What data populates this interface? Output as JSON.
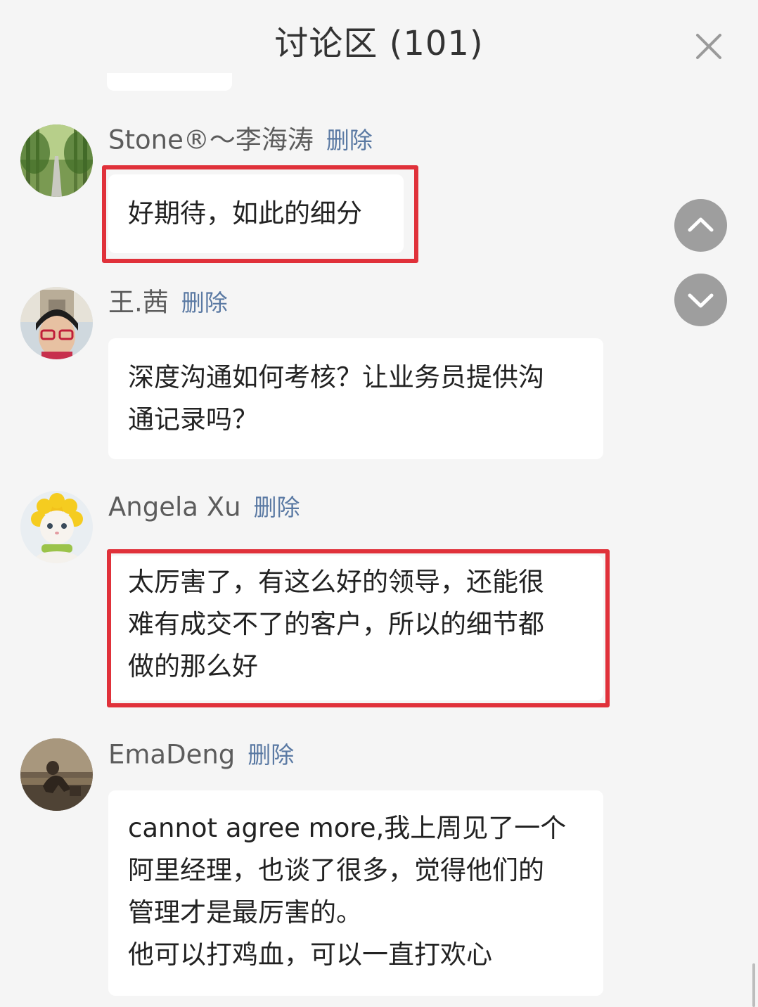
{
  "header": {
    "title": "讨论区 (101)",
    "close_icon": "close-icon"
  },
  "comments": [
    {
      "username": "Stone®～李海涛",
      "delete_label": "删除",
      "text": "好期待，如此的细分",
      "highlighted": true,
      "avatar": "tree-lined-road-photo"
    },
    {
      "username": "王.茜",
      "delete_label": "删除",
      "text": "深度沟通如何考核？让业务员提供沟\n通记录吗？",
      "highlighted": false,
      "avatar": "person-glasses-photo"
    },
    {
      "username": "Angela Xu",
      "delete_label": "删除",
      "text": "太厉害了，有这么好的领导，还能很\n难有成交不了的客户，所以的细节都\n做的那么好",
      "highlighted": true,
      "avatar": "cat-sunflower-hat-photo"
    },
    {
      "username": "EmaDeng",
      "delete_label": "删除",
      "text": "cannot agree more,我上周见了一个\n阿里经理，也谈了很多，觉得他们的\n管理才是最厉害的。\n他可以打鸡血，可以一直打欢心",
      "highlighted": false,
      "avatar": "sepia-figure-photo"
    }
  ],
  "controls": {
    "scroll_up_icon": "chevron-up-icon",
    "scroll_down_icon": "chevron-down-icon"
  },
  "colors": {
    "background": "#f5f5f5",
    "bubble": "#ffffff",
    "highlight": "#e0313a",
    "delete_link": "#5a79a3",
    "scroll_button": "#9e9e9e"
  }
}
